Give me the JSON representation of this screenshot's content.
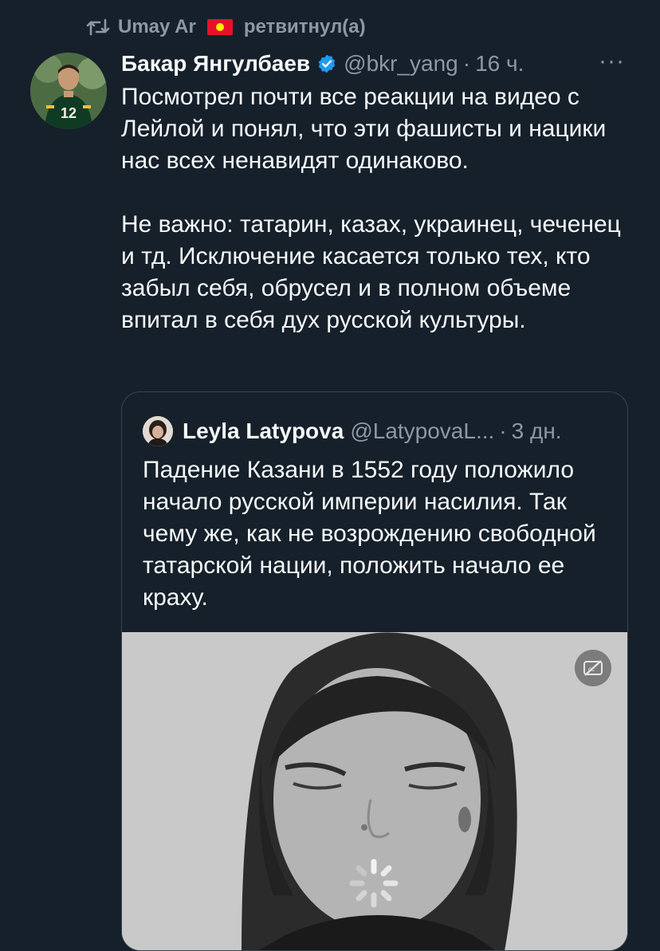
{
  "retweet": {
    "user": "Umay Ar",
    "action": "ретвитнул(а)",
    "icon": "retweet-icon",
    "flag": "kyrgyzstan-flag-icon"
  },
  "tweet": {
    "author_name": "Бакар Янгулбаев",
    "handle": "@bkr_yang",
    "separator": "·",
    "time": "16 ч.",
    "more": "···",
    "text": "Посмотрел почти все реакции на видео с Лейлой и понял, что эти фашисты и нацики нас всех ненавидят одинаково.\n\nНе важно: татарин, казах, украинец, чеченец и тд. Исключение касается только тех, кто забыл себя, обрусел и в полном объеме впитал в себя дух русской культуры."
  },
  "quote": {
    "author_name": "Leyla Latypova",
    "handle": "@LatypovaL...",
    "separator": "·",
    "time": "3 дн.",
    "text": "Падение Казани в 1552 году положило начало русской империи насилия. Так чему же, как не возрождению свободной татарской нации, положить начало ее краху.",
    "media_icon": "captions-off-icon",
    "loading_icon": "loading-spinner-icon"
  },
  "colors": {
    "background": "#15202b",
    "text": "#f7f9f9",
    "muted": "#8b98a5",
    "border": "#38444d",
    "verified": "#1d9bf0"
  }
}
